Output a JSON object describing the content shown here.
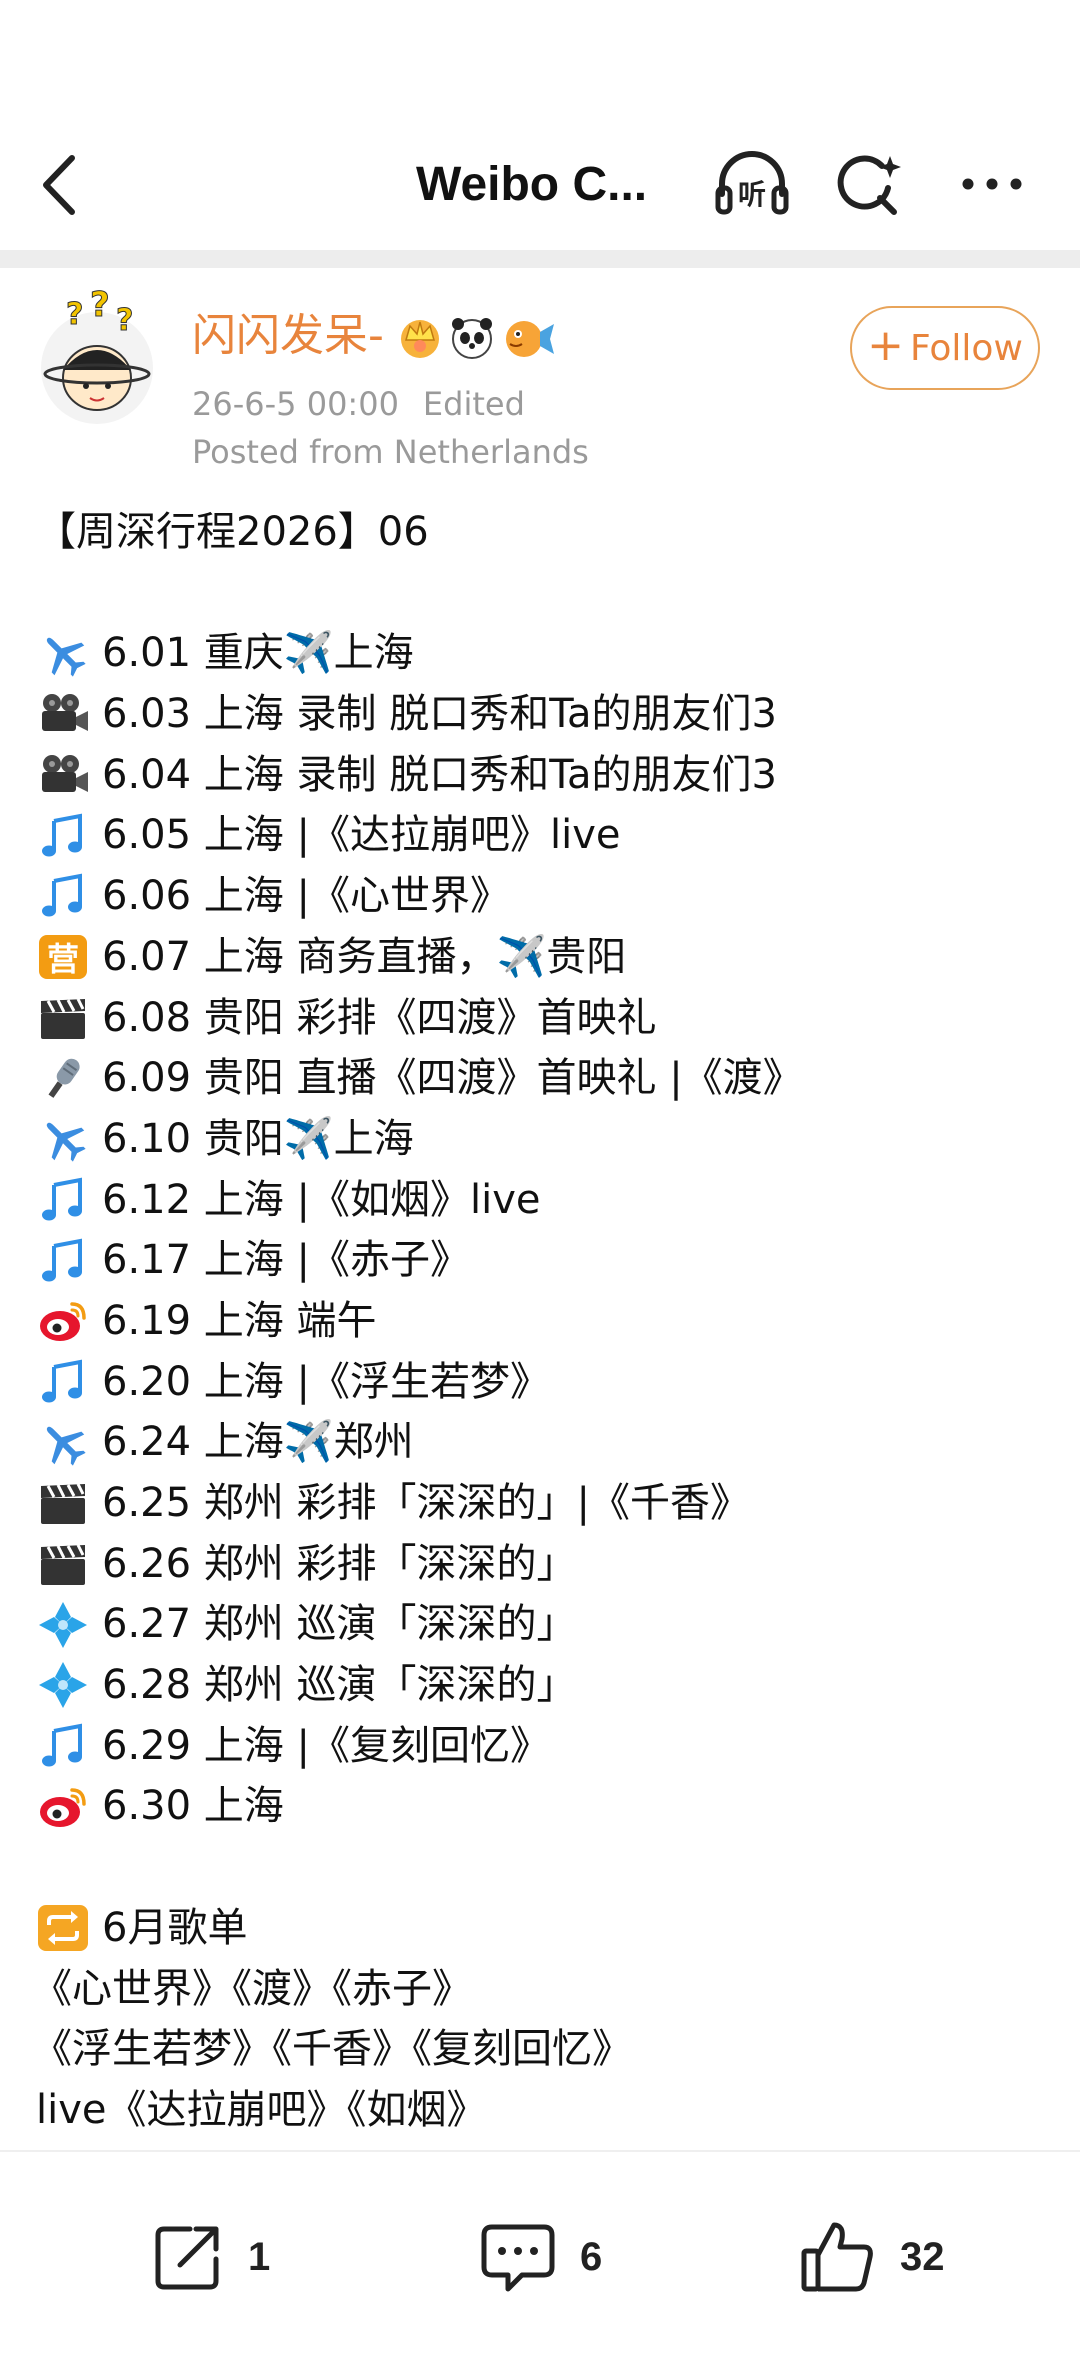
{
  "header": {
    "title": "Weibo C...",
    "icons": [
      "back-arrow-icon",
      "listen-headphones-icon",
      "search-sparkle-icon",
      "more-dots-icon"
    ],
    "listen_label": "听"
  },
  "post": {
    "username": "闪闪发呆-",
    "badges": [
      "crown-badge-icon",
      "panda-badge-icon",
      "pufferfish-badge-icon"
    ],
    "timestamp": "26-6-5 00:00",
    "edited_label": "Edited",
    "location": "Posted from Netherlands",
    "follow_label": "Follow",
    "title_line": "【周深行程2026】06",
    "schedule": [
      {
        "icon": "airplane-icon",
        "text": "6.01 重庆✈️上海"
      },
      {
        "icon": "movie-camera-icon",
        "text": "6.03 上海 录制 脱口秀和Ta的朋友们3"
      },
      {
        "icon": "movie-camera-icon",
        "text": "6.04 上海 录制 脱口秀和Ta的朋友们3"
      },
      {
        "icon": "music-note-icon",
        "text": "6.05 上海 |《达拉崩吧》live"
      },
      {
        "icon": "music-note-icon",
        "text": "6.06 上海 |《心世界》"
      },
      {
        "icon": "ying-business-icon",
        "text": "6.07 上海 商务直播，✈️贵阳"
      },
      {
        "icon": "clapperboard-icon",
        "text": "6.08 贵阳 彩排《四渡》首映礼"
      },
      {
        "icon": "microphone-icon",
        "text": "6.09 贵阳 直播《四渡》首映礼 |《渡》"
      },
      {
        "icon": "airplane-icon",
        "text": "6.10 贵阳✈️上海"
      },
      {
        "icon": "music-note-icon",
        "text": "6.12 上海 |《如烟》live"
      },
      {
        "icon": "music-note-icon",
        "text": "6.17 上海 |《赤子》"
      },
      {
        "icon": "weibo-logo-icon",
        "text": "6.19 上海 端午"
      },
      {
        "icon": "music-note-icon",
        "text": "6.20 上海 |《浮生若梦》"
      },
      {
        "icon": "airplane-icon",
        "text": "6.24 上海✈️郑州"
      },
      {
        "icon": "clapperboard-icon",
        "text": "6.25 郑州 彩排「深深的」|《千香》"
      },
      {
        "icon": "clapperboard-icon",
        "text": "6.26 郑州 彩排「深深的」"
      },
      {
        "icon": "diamond-flower-icon",
        "text": "6.27 郑州 巡演「深深的」"
      },
      {
        "icon": "diamond-flower-icon",
        "text": "6.28 郑州 巡演「深深的」"
      },
      {
        "icon": "music-note-icon",
        "text": "6.29 上海 |《复刻回忆》"
      },
      {
        "icon": "weibo-logo-icon",
        "text": "6.30 上海"
      }
    ],
    "playlist_heading": "6月歌单",
    "playlist_icon": "repeat-arrows-icon",
    "playlist_lines": [
      "《心世界》《渡》《赤子》",
      "《浮生若梦》《千香》《复刻回忆》",
      "live《达拉崩吧》《如烟》"
    ]
  },
  "actions": {
    "repost_count": "1",
    "comment_count": "6",
    "like_count": "32"
  },
  "colors": {
    "username": "#e8843c",
    "follow_border": "#e8a45a",
    "meta": "#9a9a9a",
    "divider": "#ededed",
    "music_note": "#2f8fe6"
  }
}
